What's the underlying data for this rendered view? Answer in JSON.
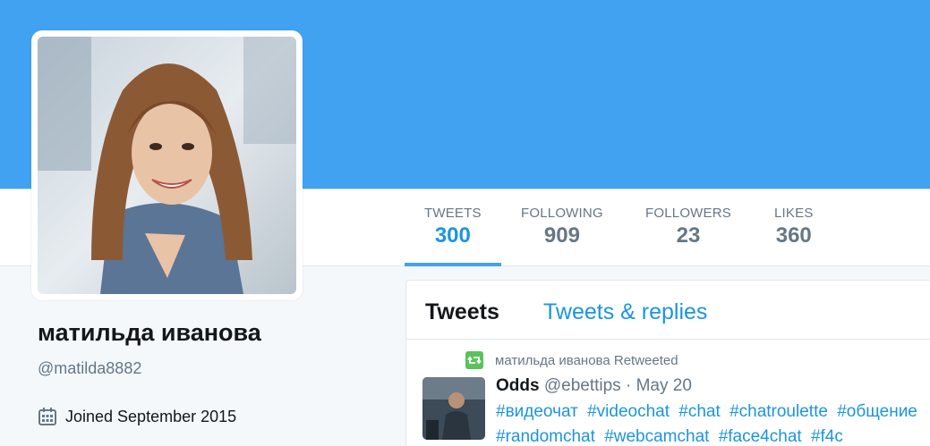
{
  "profile": {
    "name": "матильда иванова",
    "handle": "@matilda8882",
    "joined": "Joined September 2015"
  },
  "stats": [
    {
      "label": "TWEETS",
      "value": "300"
    },
    {
      "label": "FOLLOWING",
      "value": "909"
    },
    {
      "label": "FOLLOWERS",
      "value": "23"
    },
    {
      "label": "LIKES",
      "value": "360"
    }
  ],
  "timeline": {
    "tabs": [
      "Tweets",
      "Tweets & replies"
    ],
    "retweet_label": "матильда иванова Retweeted",
    "tweet": {
      "author": "Odds",
      "handle": "@ebettips",
      "separator": " · ",
      "date": "May 20",
      "hashtags": [
        "#видеочат",
        "#videochat",
        "#chat",
        "#chatroulette",
        "#общение",
        "#randomchat",
        "#webcamchat",
        "#face4chat",
        "#f4c"
      ]
    }
  },
  "colors": {
    "banner": "#40a2f1",
    "accent": "#1b95e0",
    "retweet_green": "#5bc25b"
  },
  "icons": {
    "calendar": "calendar-icon",
    "retweet": "retweet-icon"
  }
}
